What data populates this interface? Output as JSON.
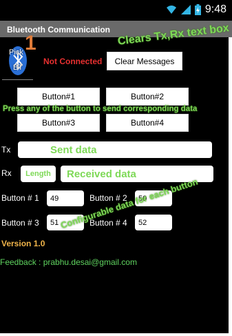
{
  "status": {
    "time": "9:48"
  },
  "app": {
    "title": "Bluetooth Communication"
  },
  "bt": {
    "pick_line1": "Pick",
    "pick_line2": "BT",
    "status": "Not Connected",
    "clear": "Clear Messages",
    "step": "1"
  },
  "buttons": [
    "Button#1",
    "Button#2",
    "Button#3",
    "Button#4"
  ],
  "tx": {
    "label": "Tx",
    "value": "Sent data"
  },
  "rx": {
    "label": "Rx",
    "length": "Length",
    "value": "Received data"
  },
  "config": [
    {
      "label": "Button # 1",
      "value": "49"
    },
    {
      "label": "Button # 2",
      "value": "50"
    },
    {
      "label": "Button # 3",
      "value": "51"
    },
    {
      "label": "Button # 4",
      "value": "52"
    }
  ],
  "version": "Version 1.0",
  "feedback": "Feedback : prabhu.desai@gmail.com",
  "annotations": {
    "clear": "Clears Tx,Rx text box",
    "press": "Press any of the button to send corresponding data",
    "config": "Configurable data for each button"
  },
  "colors": {
    "accent_red": "#e83030",
    "annotation_green": "#7ed957",
    "version_orange": "#f0b44a",
    "feedback_green": "#5fd35f"
  }
}
